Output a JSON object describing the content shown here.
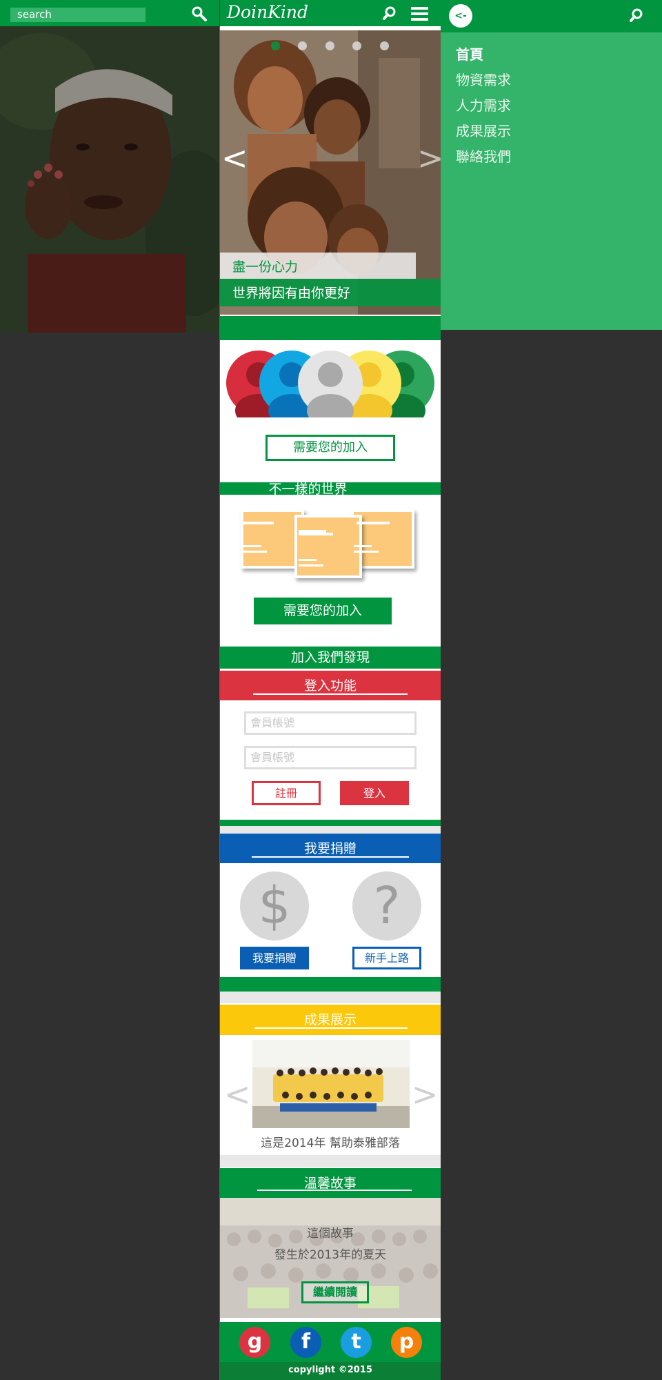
{
  "left_panel": {
    "search_text": "search"
  },
  "header": {
    "logo": "DoinKind"
  },
  "hero": {
    "slides_count": 5,
    "active_slide": 1,
    "prev_arrow": "<",
    "next_arrow": ">",
    "caption_line1": "盡一份心力",
    "caption_line2": "世界將因有由你更好"
  },
  "join_section": {
    "button_label": "需要您的加入"
  },
  "different_world": {
    "title": "不一樣的世界",
    "button_label": "需要您的加入"
  },
  "discover_band": {
    "title": "加入我們發現"
  },
  "login": {
    "title": "登入功能",
    "account_placeholder": "會員帳號",
    "password_placeholder": "會員帳號",
    "register_label": "註冊",
    "login_label": "登入"
  },
  "donate": {
    "title": "我要捐贈",
    "donate_icon": "$",
    "help_icon": "?",
    "donate_label": "我要捐贈",
    "newbie_label": "新手上路"
  },
  "results": {
    "title": "成果展示",
    "caption": "這是2014年 幫助泰雅部落",
    "prev_arrow": "<",
    "next_arrow": ">"
  },
  "stories": {
    "title": "溫馨故事",
    "line1": "這個故事",
    "line2": "發生於2013年的夏天",
    "button_label": "繼續閱讀"
  },
  "social": {
    "items": [
      "g",
      "f",
      "t",
      "p"
    ],
    "colors": [
      "#dc3340",
      "#0a5fb4",
      "#1a9ee0",
      "#f6800c"
    ]
  },
  "footer": {
    "copyright": "copylight ©2015"
  },
  "side_menu": {
    "back_label": "<-",
    "items": [
      "首頁",
      "物資需求",
      "人力需求",
      "成果展示",
      "聯絡我們"
    ]
  },
  "colors": {
    "brand_green": "#019540",
    "light_green": "#34b36a",
    "red": "#dc3340",
    "blue": "#0a5fb4",
    "yellow": "#fcc80c"
  }
}
